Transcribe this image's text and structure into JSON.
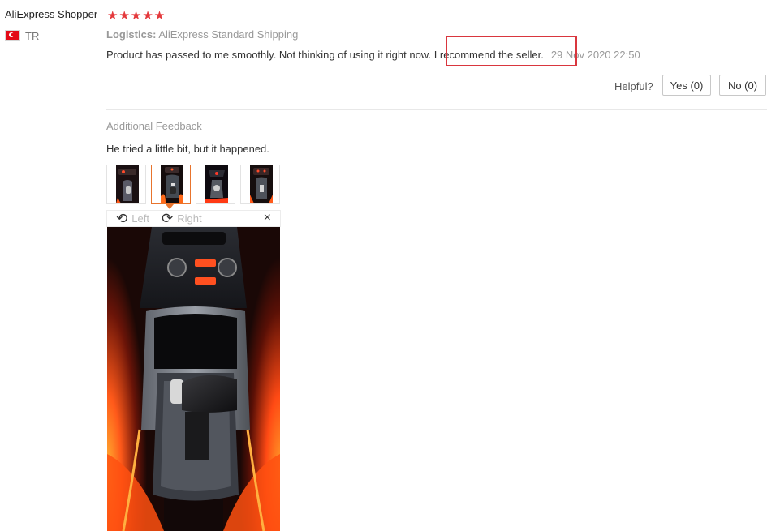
{
  "reviewer": {
    "name": "AliExpress Shopper",
    "country_code": "TR",
    "rating": 5,
    "rating_glyphs": "★★★★★"
  },
  "review": {
    "logistics_label": "Logistics:",
    "logistics_value": "AliExpress Standard Shipping",
    "text": "Product has passed to me smoothly. Not thinking of using it right now. I recommend the seller.",
    "date": "29 Nov 2020 22:50"
  },
  "helpful": {
    "label": "Helpful?",
    "yes_label": "Yes (0)",
    "no_label": "No (0)"
  },
  "additional": {
    "title": "Additional Feedback",
    "text": "He tried a little bit, but it happened."
  },
  "viewer": {
    "left_label": "Left",
    "right_label": "Right",
    "close_glyph": "×",
    "active_thumbnail": 2
  },
  "colors": {
    "star": "#e4393c",
    "highlight_box": "#d9363e",
    "active_thumb_border": "#e8742d",
    "ambient_light": "#ff5a1a"
  }
}
